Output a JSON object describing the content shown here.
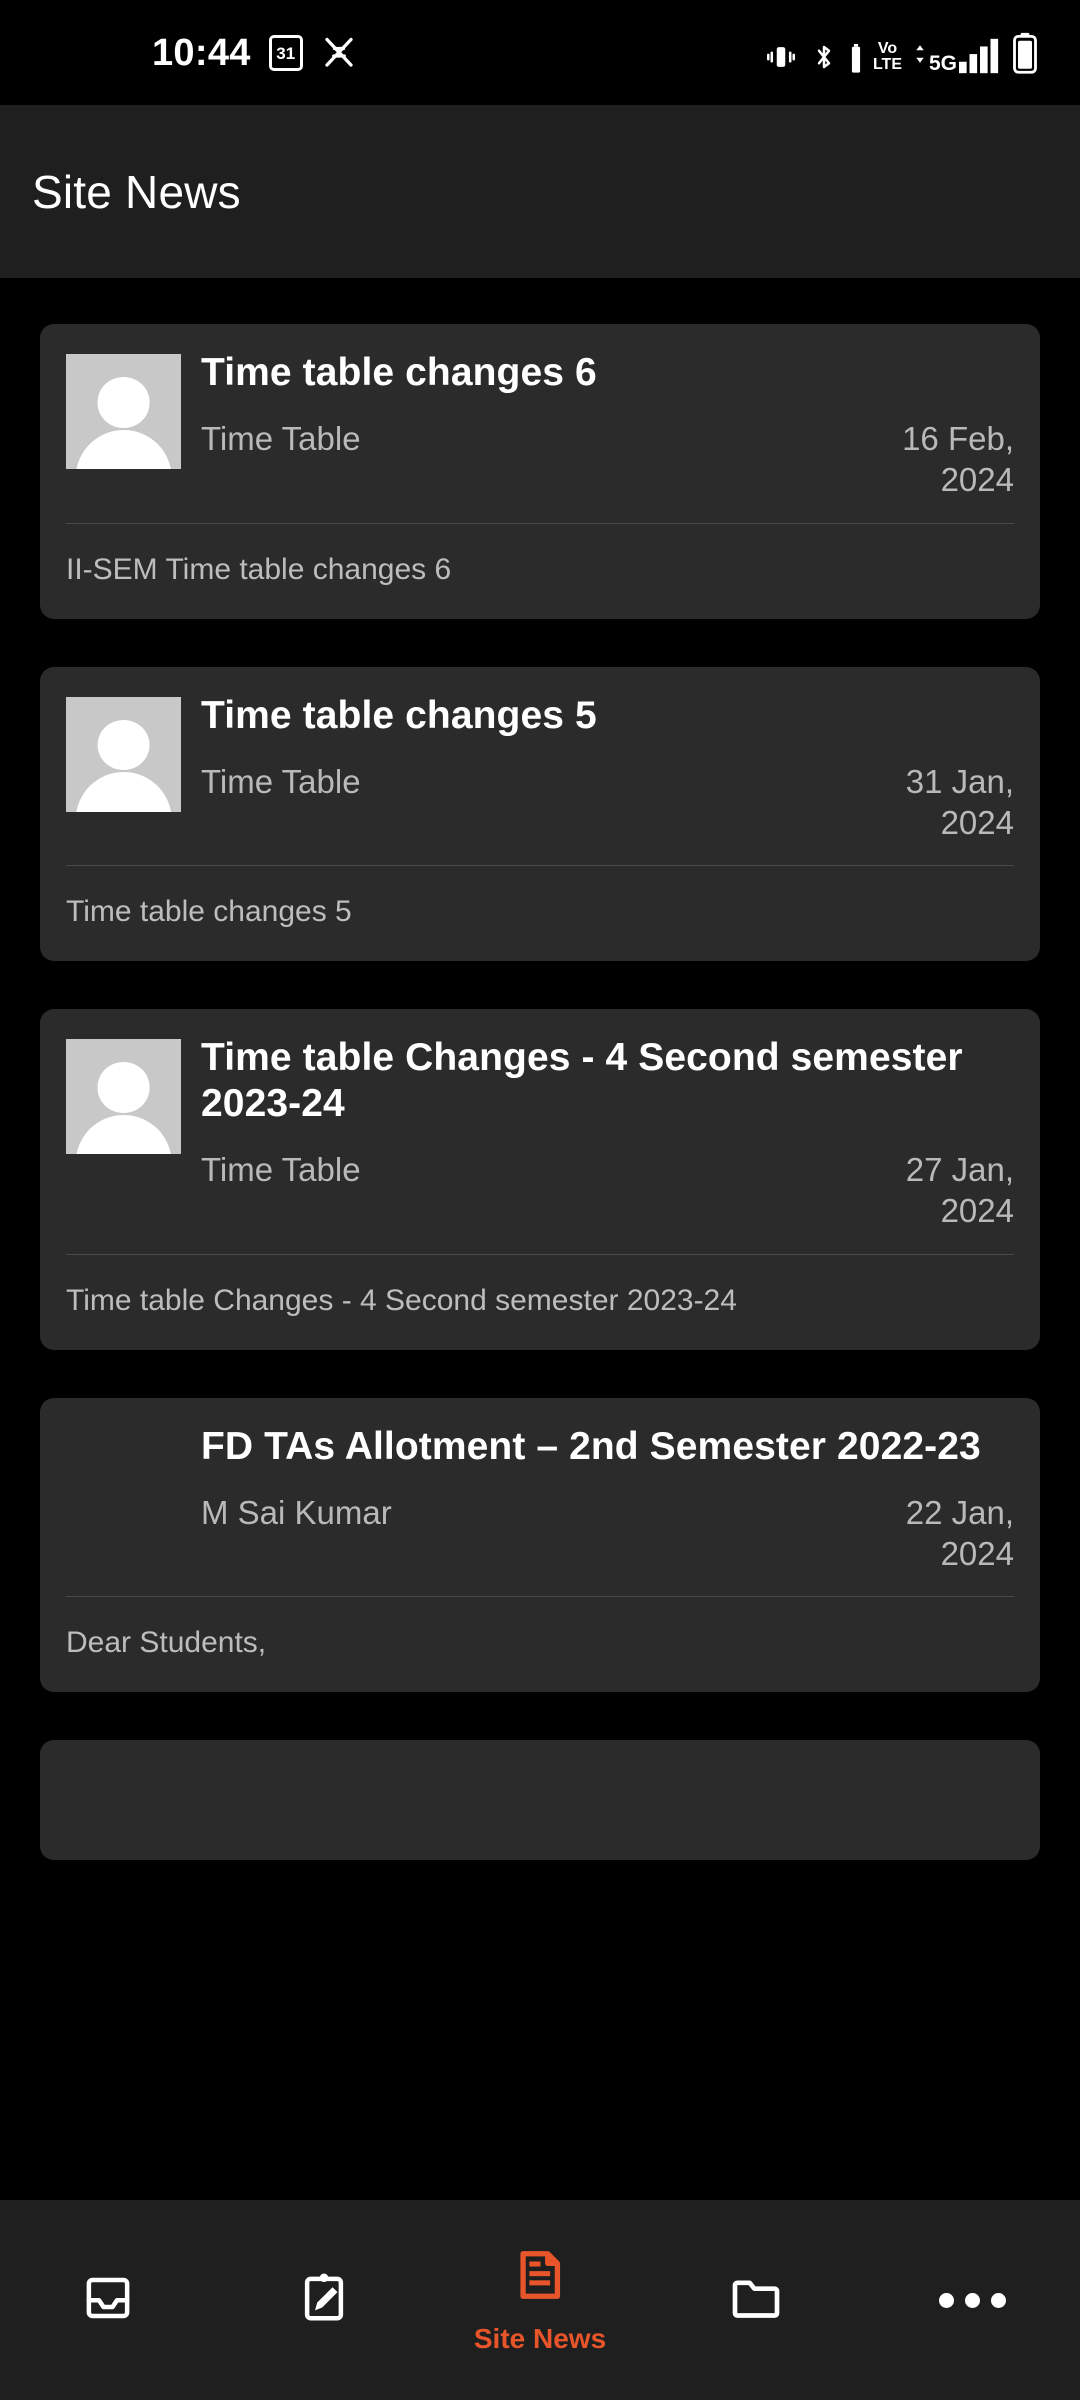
{
  "statusbar": {
    "time": "10:44",
    "calendar_day": "31",
    "icons_left": [
      "calendar-icon",
      "cut-shortcut-icon"
    ],
    "icons_right": [
      "vibrate-icon",
      "bluetooth-icon",
      "volte-icon",
      "5g-signal-icon",
      "battery-icon"
    ],
    "volte_top": "Vo",
    "volte_bottom": "LTE",
    "network": "5G"
  },
  "appbar": {
    "title": "Site News"
  },
  "news": [
    {
      "title": "Time table changes 6",
      "author": "Time Table",
      "date": "16 Feb,\n2024",
      "summary": "II-SEM Time table changes 6",
      "has_avatar": true
    },
    {
      "title": "Time table changes 5",
      "author": "Time Table",
      "date": "31 Jan,\n2024",
      "summary": "Time table changes 5",
      "has_avatar": true
    },
    {
      "title": "Time table Changes - 4 Second semester 2023-24",
      "author": "Time Table",
      "date": "27 Jan,\n2024",
      "summary": "Time table Changes - 4 Second semester 2023-24",
      "has_avatar": true
    },
    {
      "title": "FD TAs Allotment – 2nd Semester 2022-23",
      "author": "M Sai Kumar",
      "date": "22 Jan,\n2024",
      "summary": "Dear Students,",
      "has_avatar": false
    }
  ],
  "bottomnav": {
    "active_label": "Site News",
    "items": [
      {
        "icon": "inbox-icon",
        "label": "",
        "active": false
      },
      {
        "icon": "clipboard-pencil-icon",
        "label": "",
        "active": false
      },
      {
        "icon": "site-news-document-icon",
        "label": "Site News",
        "active": true
      },
      {
        "icon": "folder-icon",
        "label": "",
        "active": false
      },
      {
        "icon": "more-dots-icon",
        "label": "",
        "active": false
      }
    ]
  },
  "colors": {
    "accent": "#E8552A",
    "card_bg": "#2b2b2b",
    "appbar_bg": "#1f1f1f",
    "page_bg": "#000000",
    "muted_text": "#b9b9b9"
  }
}
